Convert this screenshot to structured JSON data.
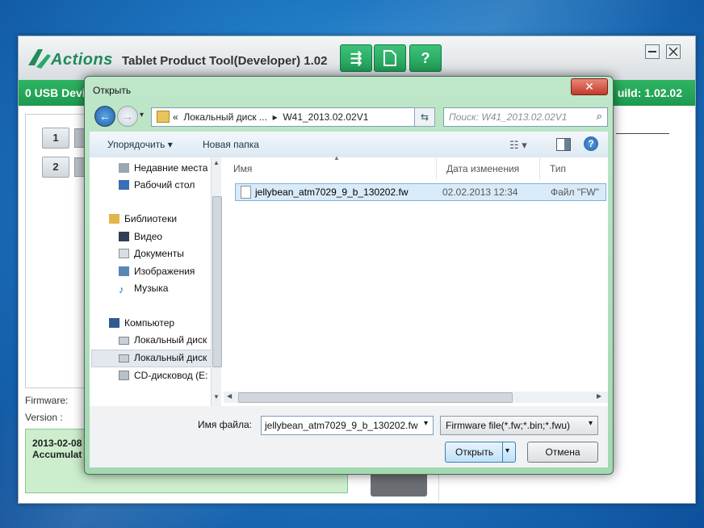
{
  "app": {
    "logo_text": "Actions",
    "title": "Tablet Product Tool(Developer) 1.02",
    "status_left": "0 USB Devi",
    "status_right": "uild: 1.02.02",
    "devices": [
      "1",
      "2"
    ],
    "firmware_label": "Firmware:",
    "version_label": "Version :",
    "log_line1": "2013-02-08",
    "log_line2": "Accumulat",
    "accent_color": "#1d9a4e"
  },
  "dialog": {
    "title": "Открыть",
    "close_glyph": "✕",
    "address": {
      "prefix": "«",
      "segment1": "Локальный диск ...",
      "sep": "▸",
      "segment2": "W41_2013.02.02V1"
    },
    "search_placeholder": "Поиск: W41_2013.02.02V1",
    "toolbar": {
      "organize": "Упорядочить ▾",
      "new_folder": "Новая папка"
    },
    "nav": [
      {
        "label": "Недавние места",
        "icon": "recent-places-icon"
      },
      {
        "label": "Рабочий стол",
        "icon": "desktop-icon"
      },
      {
        "label": "Библиотеки",
        "icon": "libraries-icon"
      },
      {
        "label": "Видео",
        "icon": "video-icon"
      },
      {
        "label": "Документы",
        "icon": "documents-icon"
      },
      {
        "label": "Изображения",
        "icon": "images-icon"
      },
      {
        "label": "Музыка",
        "icon": "music-icon"
      },
      {
        "label": "Компьютер",
        "icon": "computer-icon"
      },
      {
        "label": "Локальный диск",
        "icon": "drive-icon"
      },
      {
        "label": "Локальный диск",
        "icon": "drive-icon"
      },
      {
        "label": "CD-дисковод (E:",
        "icon": "cd-drive-icon"
      }
    ],
    "columns": {
      "name": "Имя",
      "date": "Дата изменения",
      "type": "Тип"
    },
    "file": {
      "name": "jellybean_atm7029_9_b_130202.fw",
      "date": "02.02.2013 12:34",
      "type": "Файл \"FW\""
    },
    "filename_label": "Имя файла:",
    "filename_value": "jellybean_atm7029_9_b_130202.fw",
    "filter_value": "Firmware file(*.fw;*.bin;*.fwu)",
    "open_label": "Открыть",
    "cancel_label": "Отмена"
  }
}
